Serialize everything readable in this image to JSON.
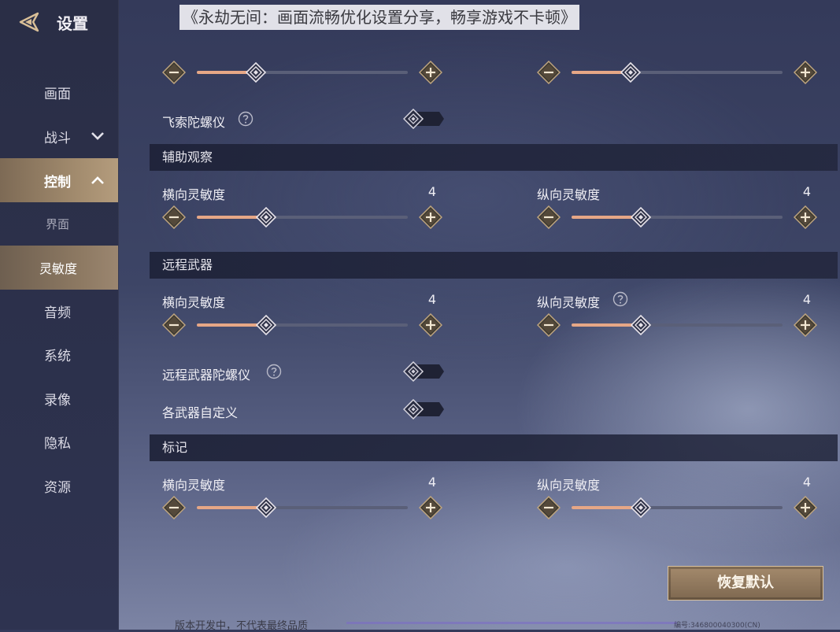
{
  "article_title": "《永劫无间：画面流畅优化设置分享，畅享游戏不卡顿》",
  "sidebar": {
    "title": "设置",
    "items": [
      {
        "label": "画面"
      },
      {
        "label": "战斗"
      },
      {
        "label": "控制"
      },
      {
        "label": "界面"
      },
      {
        "label": "灵敏度"
      },
      {
        "label": "音频"
      },
      {
        "label": "系统"
      },
      {
        "label": "录像"
      },
      {
        "label": "隐私"
      },
      {
        "label": "资源"
      }
    ],
    "active_item": "灵敏度"
  },
  "main": {
    "top_sliders": [
      {
        "level": 0.28
      },
      {
        "level": 0.28
      }
    ],
    "gyro_row": {
      "label": "飞索陀螺仪",
      "enabled": false
    },
    "sections": [
      {
        "title": "辅助观察",
        "rows": [
          {
            "label": "横向灵敏度",
            "value": "4",
            "level": 0.33
          },
          {
            "label": "纵向灵敏度",
            "value": "4",
            "level": 0.33
          }
        ]
      },
      {
        "title": "远程武器",
        "rows": [
          {
            "label": "横向灵敏度",
            "value": "4",
            "level": 0.33
          },
          {
            "label": "纵向灵敏度",
            "value": "4",
            "level": 0.33
          }
        ],
        "toggles": [
          {
            "label": "远程武器陀螺仪",
            "enabled": false
          },
          {
            "label": "各武器自定义",
            "enabled": false
          }
        ]
      },
      {
        "title": "标记",
        "rows": [
          {
            "label": "横向灵敏度",
            "value": "4",
            "level": 0.33
          },
          {
            "label": "纵向灵敏度",
            "value": "4",
            "level": 0.33
          }
        ]
      }
    ],
    "reset_button": "恢复默认"
  },
  "footer": {
    "note": "版本开发中，不代表最终品质",
    "build_id": "编号:346800040300(CN)"
  },
  "colors": {
    "accent_fill": "#e6a786",
    "button_gold": "#a48a6c",
    "sidebar_active": "#a58e70"
  }
}
